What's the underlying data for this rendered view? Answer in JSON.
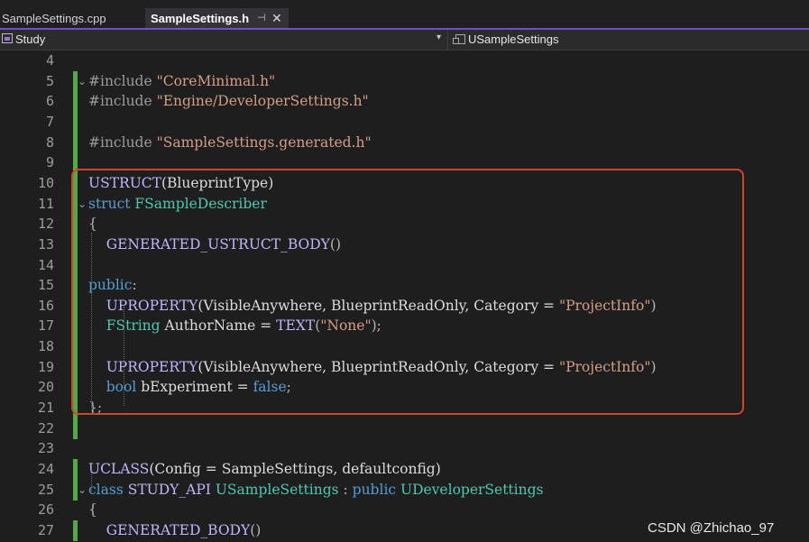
{
  "tabs": [
    {
      "label": "SampleSettings.cpp",
      "active": false
    },
    {
      "label": "SampleSettings.h",
      "active": true,
      "pin": "⊣",
      "close": "✕"
    }
  ],
  "accent_color": "#6f4fcf",
  "navbar": {
    "project": "Study",
    "project_icon": "project-icon",
    "dropdown_icon": "chevron-down-icon",
    "class_icon": "class-icon",
    "scope": "USampleSettings"
  },
  "editor": {
    "fold_open_icon": "chevron-down-icon",
    "lines": [
      {
        "n": "4",
        "changed": false,
        "fold": "",
        "tokens": []
      },
      {
        "n": "5",
        "changed": true,
        "fold": "⌄",
        "tokens": [
          {
            "t": "#include ",
            "c": "pp"
          },
          {
            "t": "\"CoreMinimal.h\"",
            "c": "str"
          }
        ]
      },
      {
        "n": "6",
        "changed": true,
        "fold": "",
        "tokens": [
          {
            "t": "#include ",
            "c": "pp"
          },
          {
            "t": "\"Engine/DeveloperSettings.h\"",
            "c": "str"
          }
        ]
      },
      {
        "n": "7",
        "changed": true,
        "fold": "",
        "tokens": []
      },
      {
        "n": "8",
        "changed": true,
        "fold": "",
        "tokens": [
          {
            "t": "#include ",
            "c": "pp"
          },
          {
            "t": "\"SampleSettings.generated.h\"",
            "c": "str"
          }
        ]
      },
      {
        "n": "9",
        "changed": true,
        "fold": "",
        "tokens": []
      },
      {
        "n": "10",
        "changed": true,
        "fold": "",
        "tokens": [
          {
            "t": "USTRUCT",
            "c": "mac"
          },
          {
            "t": "(BlueprintType)",
            "c": "id"
          }
        ]
      },
      {
        "n": "11",
        "changed": true,
        "fold": "⌄",
        "tokens": [
          {
            "t": "struct ",
            "c": "kw"
          },
          {
            "t": "FSampleDescriber",
            "c": "type"
          }
        ]
      },
      {
        "n": "12",
        "changed": true,
        "fold": "",
        "tokens": [
          {
            "t": "{",
            "c": "pun"
          }
        ]
      },
      {
        "n": "13",
        "changed": true,
        "fold": "",
        "tokens": [
          {
            "t": "    ",
            "c": "id"
          },
          {
            "t": "GENERATED_USTRUCT_BODY",
            "c": "mac"
          },
          {
            "t": "()",
            "c": "pun"
          }
        ]
      },
      {
        "n": "14",
        "changed": true,
        "fold": "",
        "tokens": []
      },
      {
        "n": "15",
        "changed": true,
        "fold": "",
        "tokens": [
          {
            "t": "public",
            "c": "kw"
          },
          {
            "t": ":",
            "c": "pun"
          }
        ]
      },
      {
        "n": "16",
        "changed": true,
        "fold": "",
        "tokens": [
          {
            "t": "    ",
            "c": "id"
          },
          {
            "t": "UPROPERTY",
            "c": "mac"
          },
          {
            "t": "(VisibleAnywhere, BlueprintReadOnly, Category = ",
            "c": "id"
          },
          {
            "t": "\"ProjectInfo\"",
            "c": "str"
          },
          {
            "t": ")",
            "c": "pun"
          }
        ]
      },
      {
        "n": "17",
        "changed": true,
        "fold": "",
        "tokens": [
          {
            "t": "    ",
            "c": "id"
          },
          {
            "t": "FString",
            "c": "type"
          },
          {
            "t": " AuthorName = ",
            "c": "id"
          },
          {
            "t": "TEXT",
            "c": "mac"
          },
          {
            "t": "(",
            "c": "pun"
          },
          {
            "t": "\"None\"",
            "c": "str"
          },
          {
            "t": ");",
            "c": "pun"
          }
        ]
      },
      {
        "n": "18",
        "changed": true,
        "fold": "",
        "tokens": []
      },
      {
        "n": "19",
        "changed": true,
        "fold": "",
        "tokens": [
          {
            "t": "    ",
            "c": "id"
          },
          {
            "t": "UPROPERTY",
            "c": "mac"
          },
          {
            "t": "(VisibleAnywhere, BlueprintReadOnly, Category = ",
            "c": "id"
          },
          {
            "t": "\"ProjectInfo\"",
            "c": "str"
          },
          {
            "t": ")",
            "c": "pun"
          }
        ]
      },
      {
        "n": "20",
        "changed": true,
        "fold": "",
        "tokens": [
          {
            "t": "    ",
            "c": "id"
          },
          {
            "t": "bool",
            "c": "kw"
          },
          {
            "t": " bExperiment = ",
            "c": "id"
          },
          {
            "t": "false",
            "c": "kw"
          },
          {
            "t": ";",
            "c": "pun"
          }
        ]
      },
      {
        "n": "21",
        "changed": true,
        "fold": "",
        "tokens": [
          {
            "t": "};",
            "c": "pun"
          }
        ]
      },
      {
        "n": "22",
        "changed": true,
        "fold": "",
        "tokens": []
      },
      {
        "n": "23",
        "changed": false,
        "fold": "",
        "tokens": []
      },
      {
        "n": "24",
        "changed": true,
        "fold": "",
        "tokens": [
          {
            "t": "UCLASS",
            "c": "mac"
          },
          {
            "t": "(Config = SampleSettings, defaultconfig)",
            "c": "id"
          }
        ]
      },
      {
        "n": "25",
        "changed": true,
        "fold": "⌄",
        "tokens": [
          {
            "t": "class ",
            "c": "kw"
          },
          {
            "t": "STUDY_API ",
            "c": "mac"
          },
          {
            "t": "USampleSettings",
            "c": "type"
          },
          {
            "t": " : ",
            "c": "pun"
          },
          {
            "t": "public ",
            "c": "kw"
          },
          {
            "t": "UDeveloperSettings",
            "c": "type"
          }
        ]
      },
      {
        "n": "26",
        "changed": false,
        "fold": "",
        "tokens": [
          {
            "t": "{",
            "c": "pun"
          }
        ]
      },
      {
        "n": "27",
        "changed": true,
        "fold": "",
        "tokens": [
          {
            "t": "    ",
            "c": "id"
          },
          {
            "t": "GENERATED_BODY",
            "c": "mac"
          },
          {
            "t": "()",
            "c": "pun"
          }
        ]
      }
    ]
  },
  "highlight_box_color": "#d0432e",
  "watermark": "CSDN @Zhichao_97"
}
